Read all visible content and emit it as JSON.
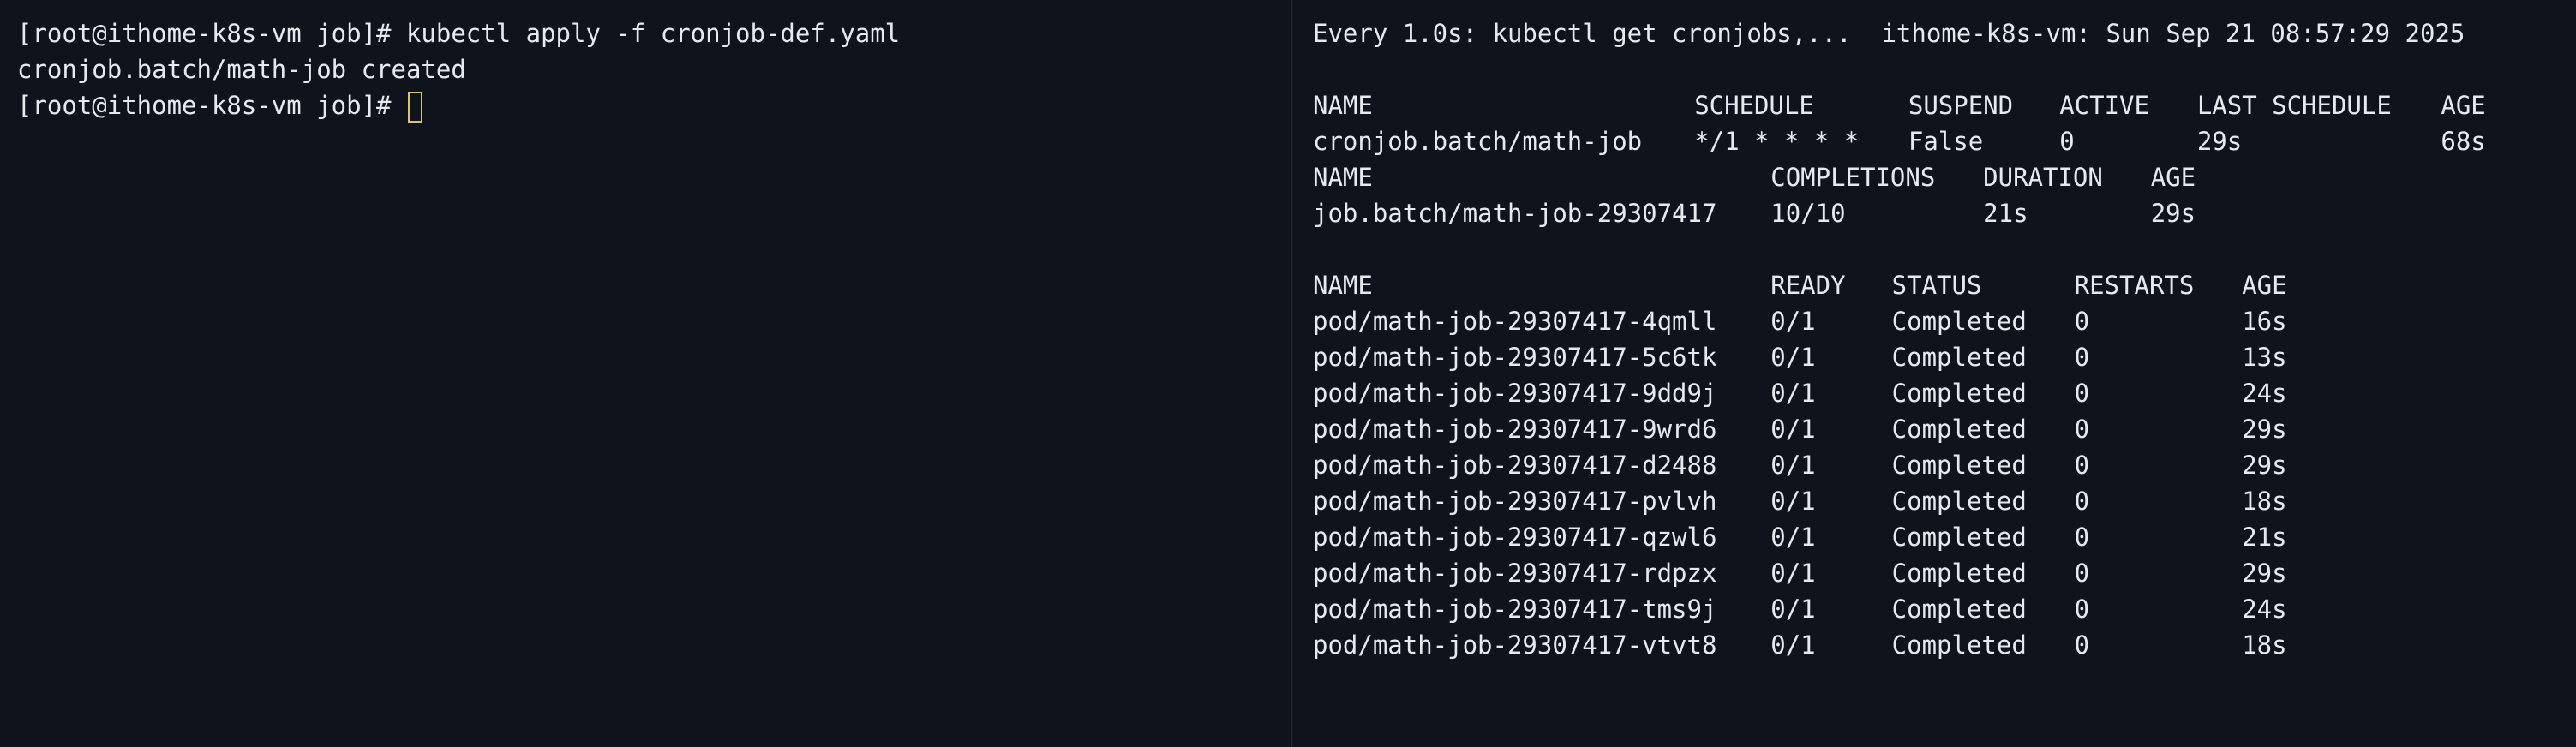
{
  "left": {
    "lines": [
      "[root@ithome-k8s-vm job]# kubectl apply -f cronjob-def.yaml",
      "cronjob.batch/math-job created"
    ],
    "prompt": "[root@ithome-k8s-vm job]# "
  },
  "right": {
    "watch_header": "Every 1.0s: kubectl get cronjobs,...  ithome-k8s-vm: Sun Sep 21 08:57:29 2025",
    "cronjobs": {
      "headers": [
        "NAME",
        "SCHEDULE",
        "SUSPEND",
        "ACTIVE",
        "LAST SCHEDULE",
        "AGE"
      ],
      "rows": [
        [
          "cronjob.batch/math-job",
          "*/1 * * * *",
          "False",
          "0",
          "29s",
          "68s"
        ]
      ]
    },
    "jobs": {
      "headers": [
        "NAME",
        "COMPLETIONS",
        "DURATION",
        "AGE"
      ],
      "rows": [
        [
          "job.batch/math-job-29307417",
          "10/10",
          "21s",
          "29s"
        ]
      ]
    },
    "pods": {
      "headers": [
        "NAME",
        "READY",
        "STATUS",
        "RESTARTS",
        "AGE"
      ],
      "rows": [
        [
          "pod/math-job-29307417-4qmll",
          "0/1",
          "Completed",
          "0",
          "16s"
        ],
        [
          "pod/math-job-29307417-5c6tk",
          "0/1",
          "Completed",
          "0",
          "13s"
        ],
        [
          "pod/math-job-29307417-9dd9j",
          "0/1",
          "Completed",
          "0",
          "24s"
        ],
        [
          "pod/math-job-29307417-9wrd6",
          "0/1",
          "Completed",
          "0",
          "29s"
        ],
        [
          "pod/math-job-29307417-d2488",
          "0/1",
          "Completed",
          "0",
          "29s"
        ],
        [
          "pod/math-job-29307417-pvlvh",
          "0/1",
          "Completed",
          "0",
          "18s"
        ],
        [
          "pod/math-job-29307417-qzwl6",
          "0/1",
          "Completed",
          "0",
          "21s"
        ],
        [
          "pod/math-job-29307417-rdpzx",
          "0/1",
          "Completed",
          "0",
          "29s"
        ],
        [
          "pod/math-job-29307417-tms9j",
          "0/1",
          "Completed",
          "0",
          "24s"
        ],
        [
          "pod/math-job-29307417-vtvt8",
          "0/1",
          "Completed",
          "0",
          "18s"
        ]
      ]
    }
  },
  "colors": {
    "background": "#0f141c",
    "text": "#e6e9ee",
    "cursor": "#d8c37a",
    "divider": "#242a33"
  }
}
